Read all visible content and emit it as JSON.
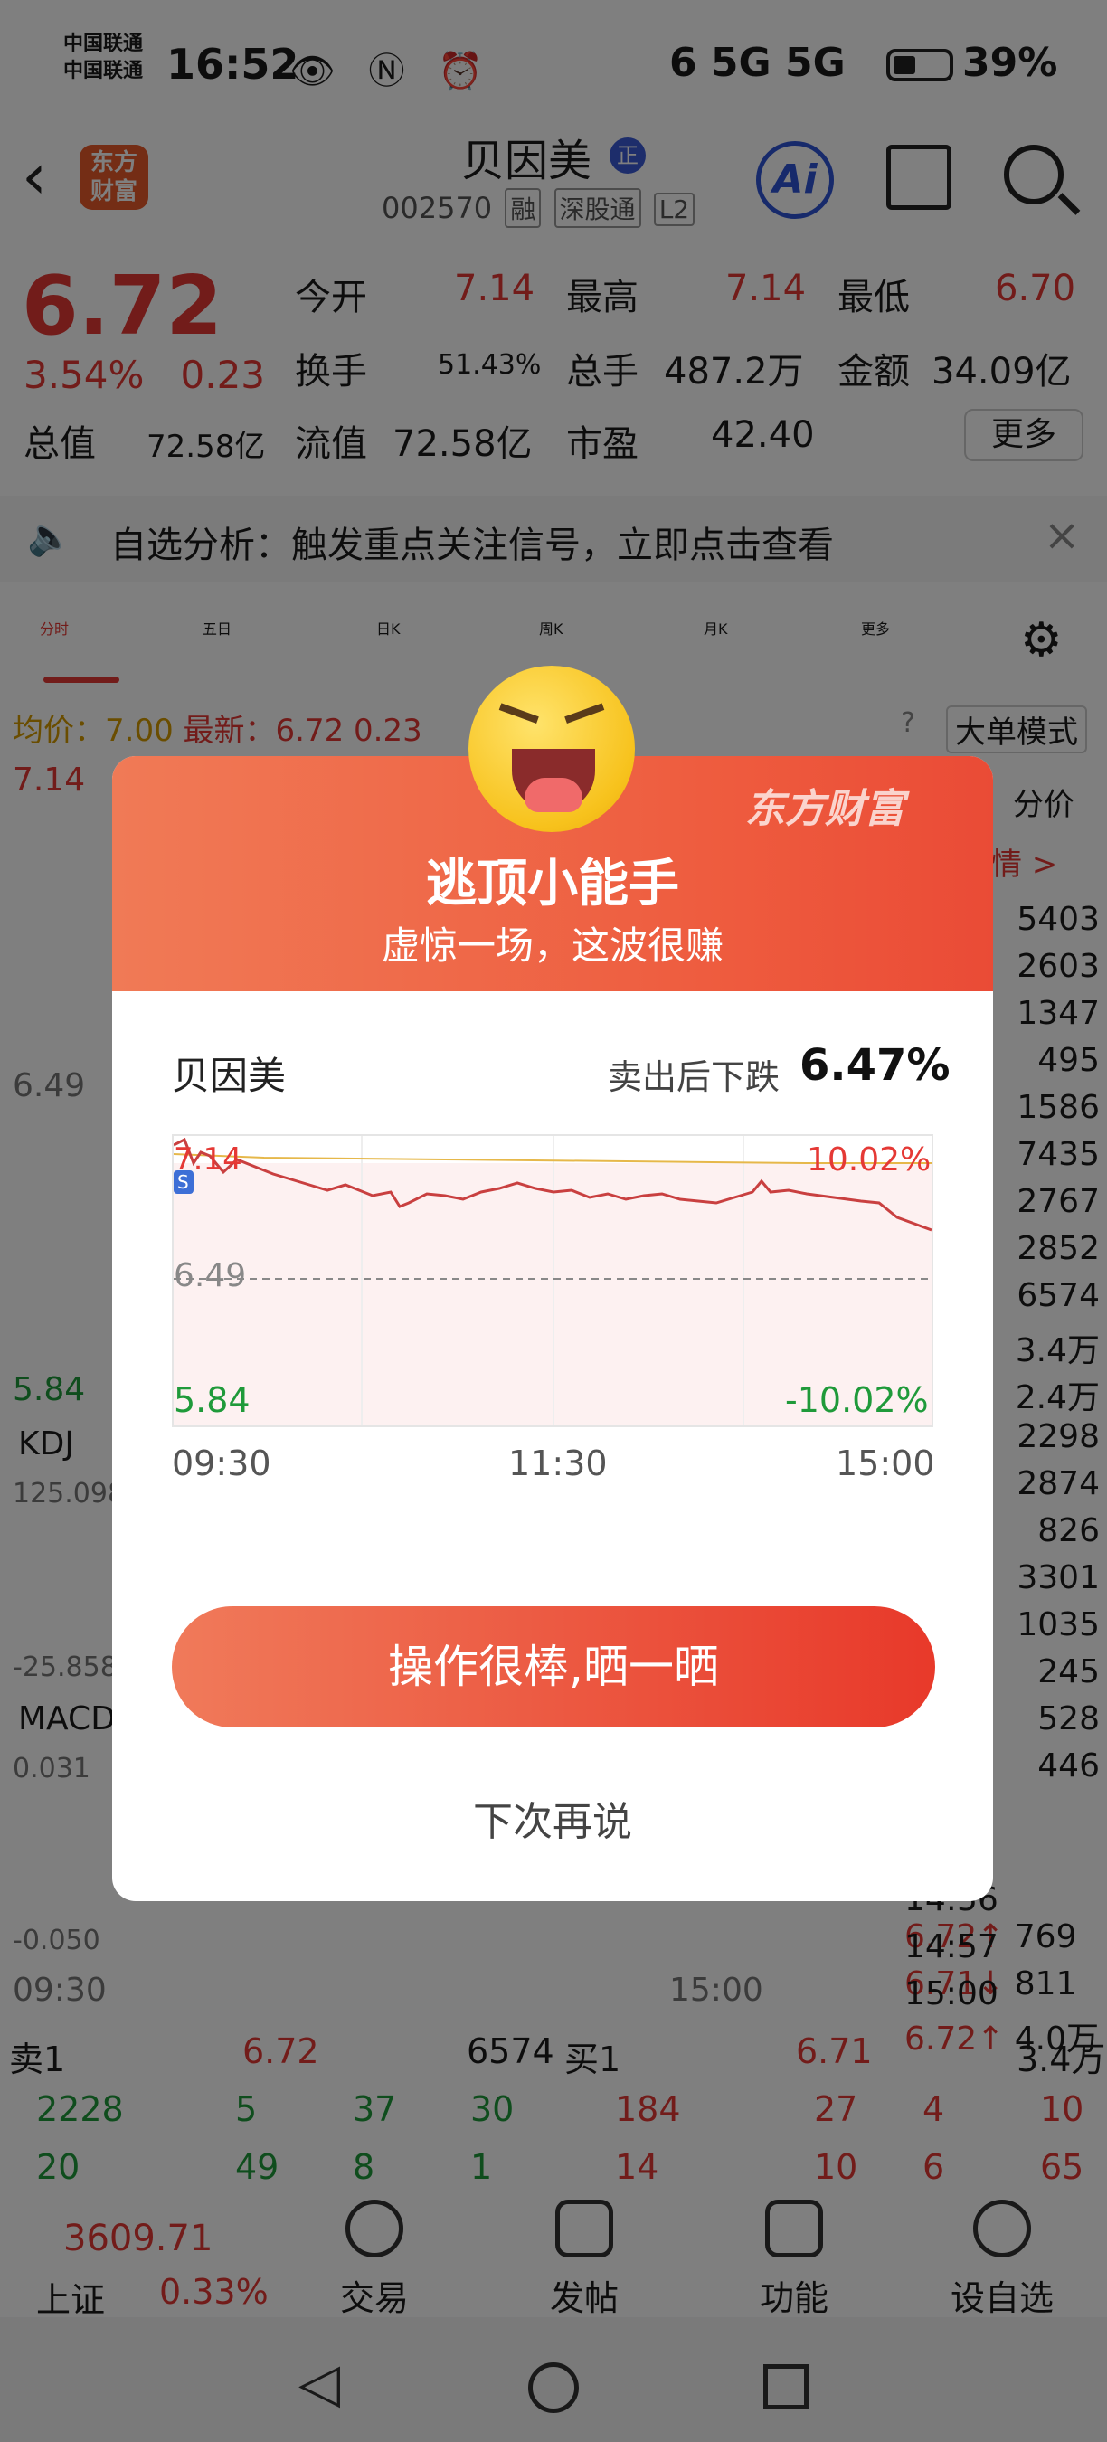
{
  "status": {
    "carrier1": "中国联通",
    "carrier2": "中国联通",
    "time": "16:52",
    "net": "6 5G 5G",
    "battery": "39%"
  },
  "header": {
    "logo": "东方财富",
    "name": "贝因美",
    "zheng": "正",
    "code": "002570",
    "tags": [
      "融",
      "深股通",
      "L2"
    ],
    "ai": "Ai"
  },
  "quote": {
    "price": "6.72",
    "pct": "3.54%",
    "chg": "0.23",
    "open_label": "今开",
    "open": "7.14",
    "high_label": "最高",
    "high": "7.14",
    "low_label": "最低",
    "low": "6.70",
    "turn_label": "换手",
    "turn": "51.43%",
    "vol_label": "总手",
    "vol": "487.2万",
    "amt_label": "金额",
    "amt": "34.09亿",
    "cap_label": "总值",
    "cap": "72.58亿",
    "float_label": "流值",
    "float": "72.58亿",
    "pe_label": "市盈",
    "pe": "42.40",
    "more": "更多"
  },
  "alert": {
    "text": "自选分析：触发重点关注信号，立即点击查看"
  },
  "tabs": [
    "分时",
    "五日",
    "日K",
    "周K",
    "月K",
    "更多"
  ],
  "chartinfo": {
    "avg": "均价：7.00",
    "last": "最新：6.72",
    "chg": "0.23",
    "mode": "大单模式",
    "ymax": "7.14",
    "ymid": "6.49",
    "ymin": "5.84",
    "kdj": "KDJ",
    "kdj_top": "125.098",
    "kdj_bot": "-25.858",
    "macd": "MACD",
    "macd_top": "0.031",
    "macd_bot": "-0.050",
    "t0": "09:30",
    "t1": "15:00",
    "fenjia": "分价",
    "qing": "情 >"
  },
  "rightcol": [
    "5403",
    "2603",
    "1347",
    "495",
    "1586",
    "7435",
    "2767",
    "2852",
    "6574",
    "3.4万",
    "2.4万",
    "2298",
    "2874",
    "826",
    "3301",
    "1035",
    "245",
    "528",
    "446"
  ],
  "ticks": [
    {
      "t": "14:56",
      "p": "6.72↑",
      "v": "769"
    },
    {
      "t": "14:57",
      "p": "6.71↓",
      "v": "811"
    },
    {
      "t": "15:00",
      "p": "6.72↑",
      "v": "4.0万"
    }
  ],
  "orderbook": {
    "sell1": "卖1",
    "sell1p": "6.72",
    "sell1v": "6574",
    "buy1": "买1",
    "buy1p": "6.71",
    "buy1v": "3.4万",
    "r1": [
      "2228",
      "5",
      "37",
      "30",
      "184",
      "27",
      "4",
      "10"
    ],
    "r2": [
      "20",
      "49",
      "8",
      "1",
      "14",
      "10",
      "6",
      "65"
    ]
  },
  "modal": {
    "brand": "东方财富",
    "title": "逃顶小能手",
    "subtitle": "虚惊一场，这波很赚",
    "name": "贝因美",
    "label": "卖出后下跌",
    "value": "6.47%",
    "ymax": "7.14",
    "pct_top": "10.02%",
    "ymid": "6.49",
    "ymin": "5.84",
    "pct_bot": "-10.02%",
    "t0": "09:30",
    "t1": "11:30",
    "t2": "15:00",
    "button": "操作很棒,晒一晒",
    "later": "下次再说"
  },
  "bottom": {
    "index": "3609.71",
    "index_name": "上证",
    "index_pct": "0.33%",
    "items": [
      "交易",
      "发帖",
      "功能",
      "设自选"
    ]
  }
}
